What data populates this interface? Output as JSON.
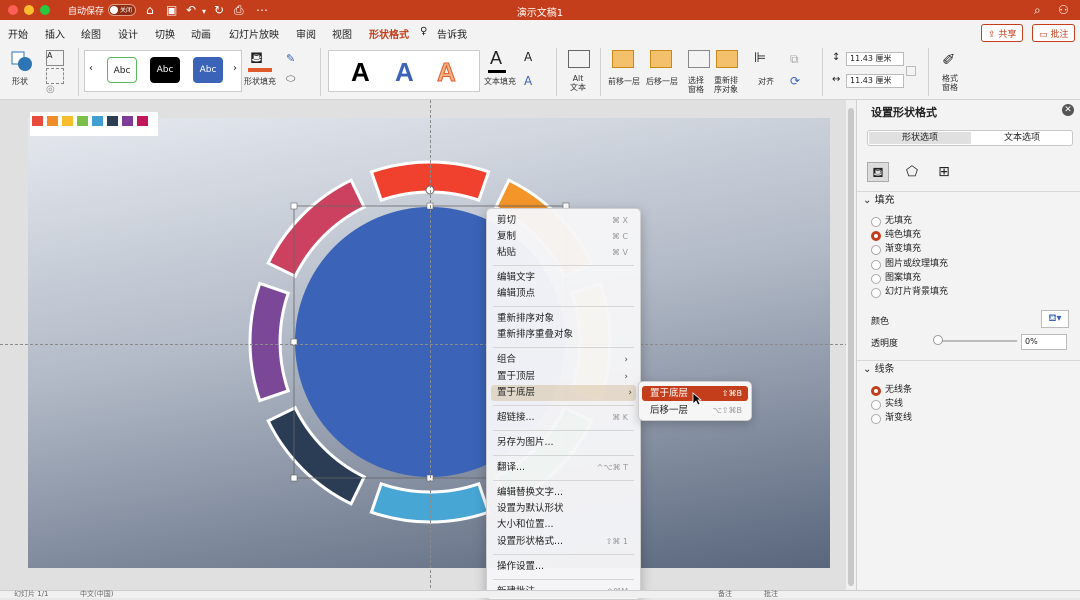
{
  "titlebar": {
    "autosave_label": "自动保存",
    "autosave_state": "关闭",
    "doc_title": "演示文稿1"
  },
  "tabs": [
    "开始",
    "插入",
    "绘图",
    "设计",
    "切换",
    "动画",
    "幻灯片放映",
    "审阅",
    "视图",
    "形状格式",
    "告诉我"
  ],
  "active_tab": "形状格式",
  "share": {
    "share_label": "共享",
    "comment_label": "批注"
  },
  "ribbon": {
    "shape_label": "形状",
    "styles": [
      "Abc",
      "Abc",
      "Abc"
    ],
    "shape_fill_label": "形状填充",
    "wordart": [
      "A",
      "A",
      "A"
    ],
    "text_fill_label": "文本填充",
    "alt_text_label": "Alt\n文本",
    "bring_forward": "前移一层",
    "send_backward": "后移一层",
    "selection_pane": "选择\n窗格",
    "rearrange": "重新排\n序对象",
    "align": "对齐",
    "height_value": "11.43 厘米",
    "width_value": "11.43 厘米",
    "format_pane": "格式\n窗格"
  },
  "swatch_colors": [
    "#e84c3d",
    "#f08c2a",
    "#f6be2d",
    "#7cbf4b",
    "#3f9fd0",
    "#2c3e50",
    "#7d3c98",
    "#c2185b"
  ],
  "flower": {
    "petal_colors": [
      "#f0412f",
      "#f4952a",
      "#f5c031",
      "#5cb85c",
      "#48a6d4",
      "#2a3d55",
      "#7a4896",
      "#cc4160"
    ],
    "center_color": "#3b63b8"
  },
  "context_menu": {
    "items": [
      {
        "label": "剪切",
        "shortcut": "⌘ X"
      },
      {
        "label": "复制",
        "shortcut": "⌘ C"
      },
      {
        "label": "粘贴",
        "shortcut": "⌘ V"
      },
      {
        "label": "编辑文字",
        "shortcut": ""
      },
      {
        "label": "编辑顶点",
        "shortcut": ""
      },
      {
        "label": "重新排序对象",
        "shortcut": ""
      },
      {
        "label": "重新排序重叠对象",
        "shortcut": ""
      },
      {
        "label": "组合",
        "shortcut": "",
        "submenu": true
      },
      {
        "label": "置于顶层",
        "shortcut": "",
        "submenu": true
      },
      {
        "label": "置于底层",
        "shortcut": "",
        "submenu": true
      },
      {
        "label": "超链接...",
        "shortcut": "⌘ K"
      },
      {
        "label": "另存为图片...",
        "shortcut": ""
      },
      {
        "label": "翻译...",
        "shortcut": "^⌥⌘ T"
      },
      {
        "label": "编辑替换文字...",
        "shortcut": ""
      },
      {
        "label": "设置为默认形状",
        "shortcut": ""
      },
      {
        "label": "大小和位置...",
        "shortcut": ""
      },
      {
        "label": "设置形状格式...",
        "shortcut": "⇧⌘ 1"
      },
      {
        "label": "操作设置...",
        "shortcut": ""
      },
      {
        "label": "新建批注",
        "shortcut": "⇧⌘M"
      }
    ]
  },
  "submenu": {
    "items": [
      {
        "label": "置于底层",
        "shortcut": "⇧⌘B"
      },
      {
        "label": "后移一层",
        "shortcut": "⌥⇧⌘B"
      }
    ]
  },
  "panel": {
    "title": "设置形状格式",
    "tab_shape": "形状选项",
    "tab_text": "文本选项",
    "fill_section": "填充",
    "fill_options": [
      "无填充",
      "纯色填充",
      "渐变填充",
      "图片或纹理填充",
      "图案填充",
      "幻灯片背景填充"
    ],
    "fill_checked": "纯色填充",
    "color_label": "颜色",
    "transparency_label": "透明度",
    "transparency_value": "0%",
    "line_section": "线条",
    "line_options": [
      "无线条",
      "实线",
      "渐变线"
    ],
    "line_checked": "无线条"
  },
  "statusbar": {
    "slide_label": "幻灯片 1/1",
    "lang": "中文(中国)",
    "notes": "备注",
    "comments": "批注"
  }
}
